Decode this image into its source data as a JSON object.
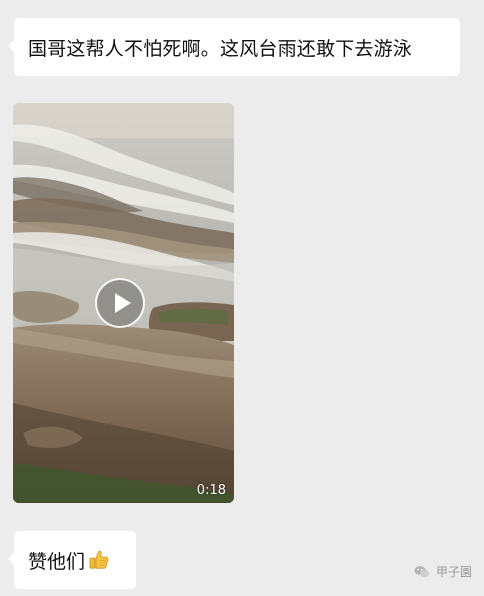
{
  "messages": {
    "first": {
      "text": "国哥这帮人不怕死啊。这风台雨还敢下去游泳"
    },
    "video": {
      "duration": "0:18",
      "icon": "play-icon"
    },
    "second": {
      "text": "赞他们",
      "emoji": "thumbs-up-icon"
    }
  },
  "watermark": {
    "text": "甲子園",
    "icon": "wechat-icon"
  },
  "colors": {
    "background": "#ececed",
    "bubble": "#ffffff",
    "text": "#111111",
    "watermark": "#9a9a9a"
  }
}
